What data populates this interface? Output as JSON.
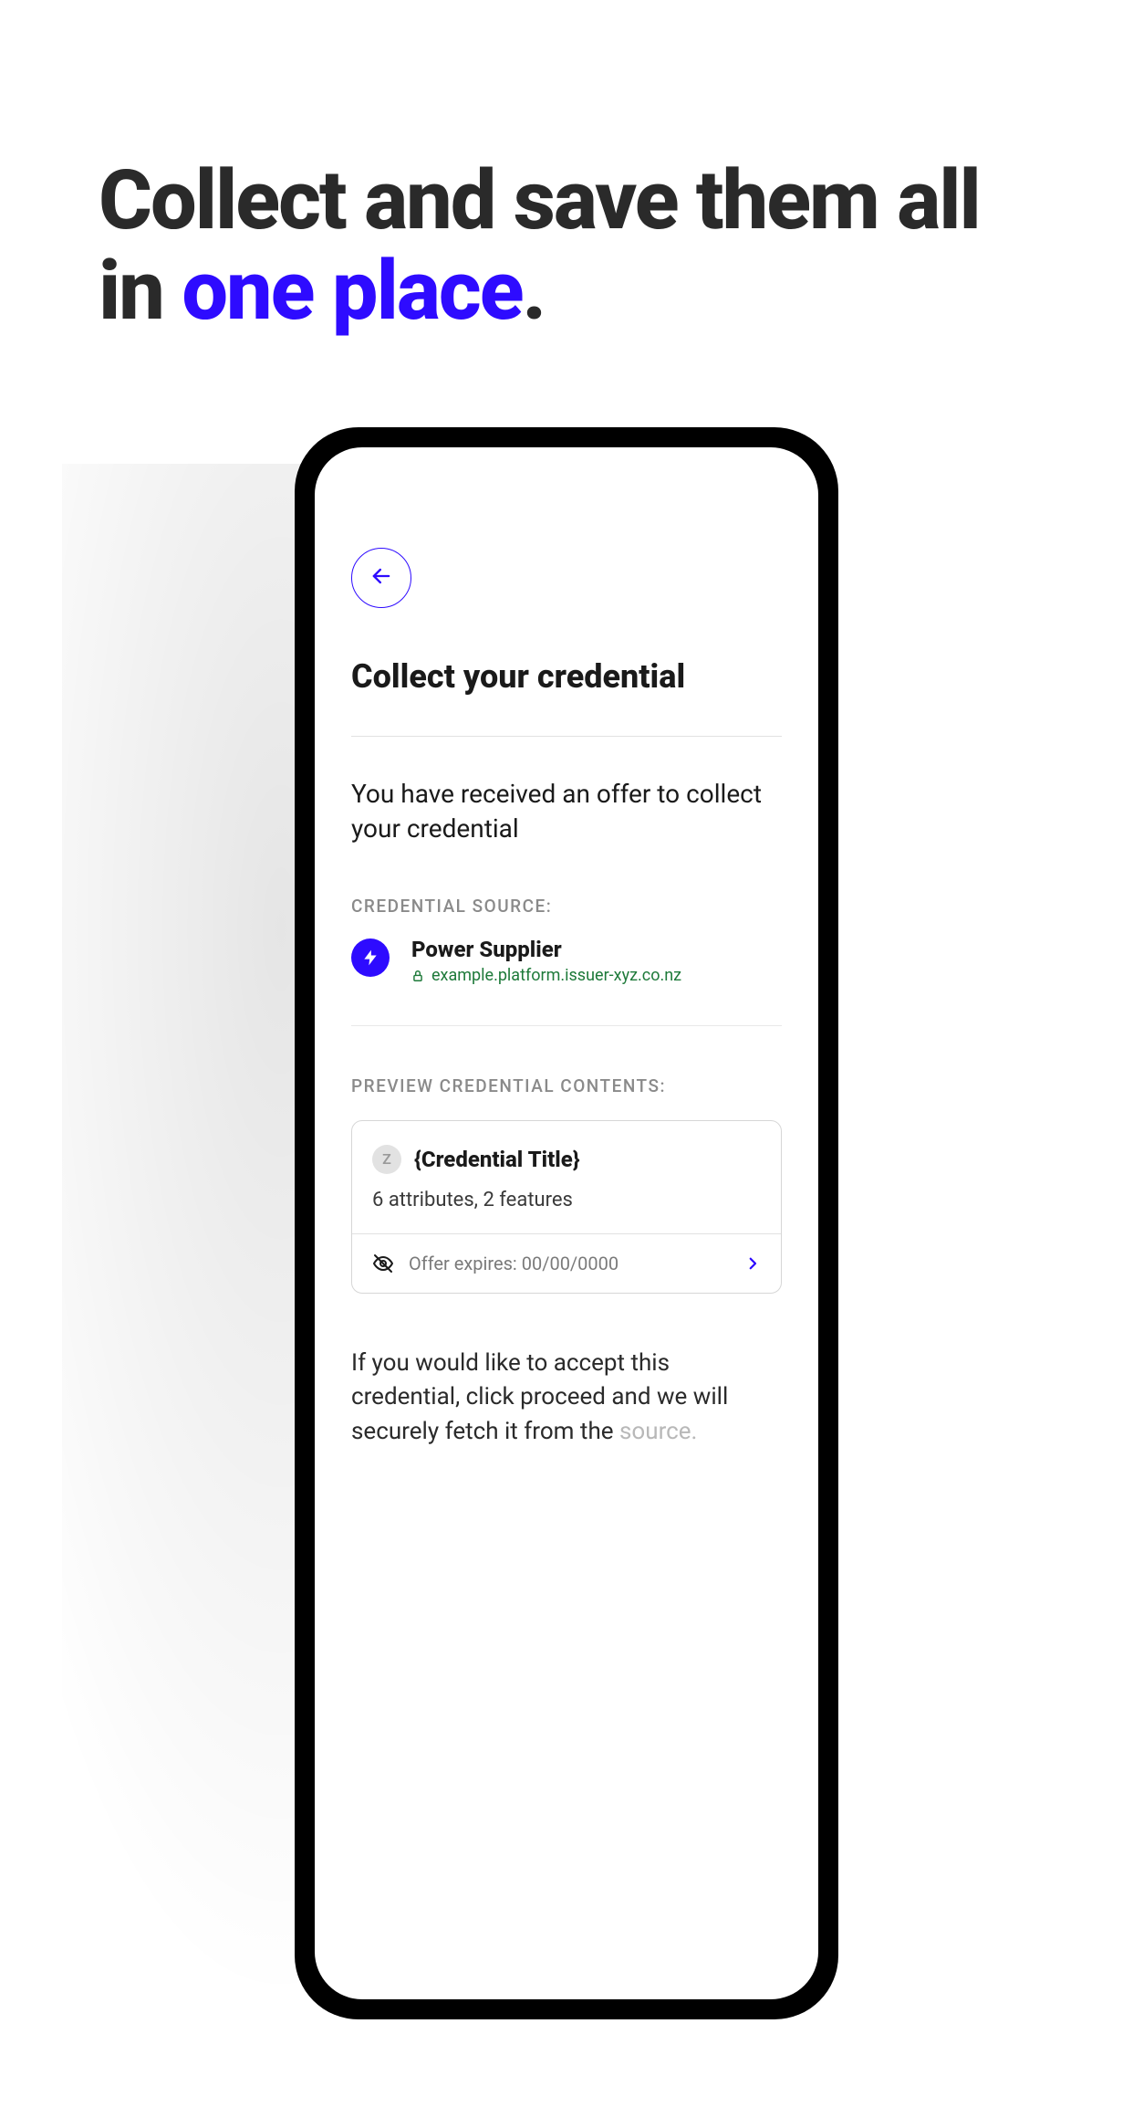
{
  "headline": {
    "part1": "Collect and save them all in ",
    "accent": "one place",
    "part2": "."
  },
  "screen": {
    "title": "Collect your credential",
    "offer_text": "You have received an offer to collect your credential",
    "source_label": "CREDENTIAL SOURCE:",
    "source": {
      "name": "Power Supplier",
      "domain": "example.platform.issuer-xyz.co.nz"
    },
    "preview_label": "PREVIEW CREDENTIAL CONTENTS:",
    "preview": {
      "badge_letter": "Z",
      "title": "{Credential Title}",
      "meta": "6 attributes, 2 features",
      "expires": "Offer expires: 00/00/0000"
    },
    "accept_text_main": "If you would like to accept this credential, click proceed and we will securely fetch it from the ",
    "accept_text_faded": "source."
  }
}
